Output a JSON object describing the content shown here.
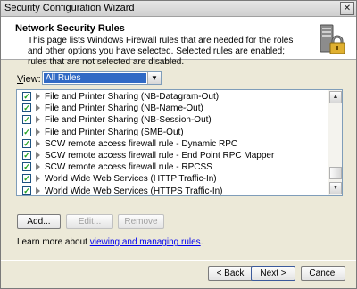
{
  "window": {
    "title": "Security Configuration Wizard",
    "close_glyph": "✕"
  },
  "header": {
    "title": "Network Security Rules",
    "description": "This page lists Windows Firewall rules that are needed for the roles and other options you have selected. Selected rules are enabled; rules that are not selected are disabled."
  },
  "view": {
    "label": "View:",
    "selected": "All Rules"
  },
  "rules": [
    {
      "label": "File and Printer Sharing (NB-Datagram-Out)",
      "checked": true
    },
    {
      "label": "File and Printer Sharing (NB-Name-Out)",
      "checked": true
    },
    {
      "label": "File and Printer Sharing (NB-Session-Out)",
      "checked": true
    },
    {
      "label": "File and Printer Sharing (SMB-Out)",
      "checked": true
    },
    {
      "label": "SCW remote access firewall rule - Dynamic RPC",
      "checked": true
    },
    {
      "label": "SCW remote access firewall rule - End Point RPC Mapper",
      "checked": true
    },
    {
      "label": "SCW remote access firewall rule - RPCSS",
      "checked": true
    },
    {
      "label": "World Wide Web Services (HTTP Traffic-In)",
      "checked": true
    },
    {
      "label": "World Wide Web Services (HTTPS Traffic-In)",
      "checked": true
    }
  ],
  "list_buttons": {
    "add": "Add...",
    "edit": "Edit...",
    "remove": "Remove"
  },
  "learn": {
    "prefix": "Learn more about ",
    "link": "viewing and managing rules",
    "suffix": "."
  },
  "footer": {
    "back": "< Back",
    "next": "Next >",
    "cancel": "Cancel"
  },
  "colors": {
    "selection": "#316ac5",
    "link": "#0000ee",
    "check": "#21a121"
  }
}
